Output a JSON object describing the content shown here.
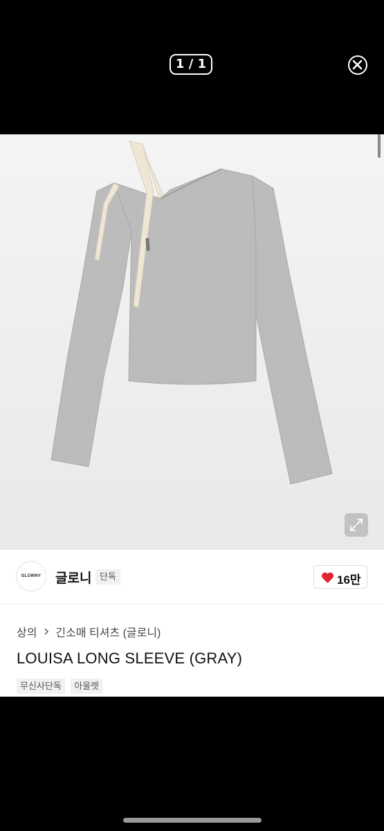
{
  "viewer": {
    "counter": "1 / 1"
  },
  "brand": {
    "logo_text": "GLOWNY",
    "name": "글로니",
    "badge": "단독"
  },
  "likes": {
    "count": "16만"
  },
  "breadcrumb": {
    "category": "상의",
    "subcategory": "긴소매 티셔츠 (글로니)"
  },
  "product": {
    "title": "LOUISA LONG SLEEVE (GRAY)"
  },
  "tags": [
    "무신사단독",
    "아울렛"
  ],
  "colors": {
    "heart": "#e0242f",
    "sweater": "#b9b9b9",
    "ribbon": "#efe6d6"
  }
}
